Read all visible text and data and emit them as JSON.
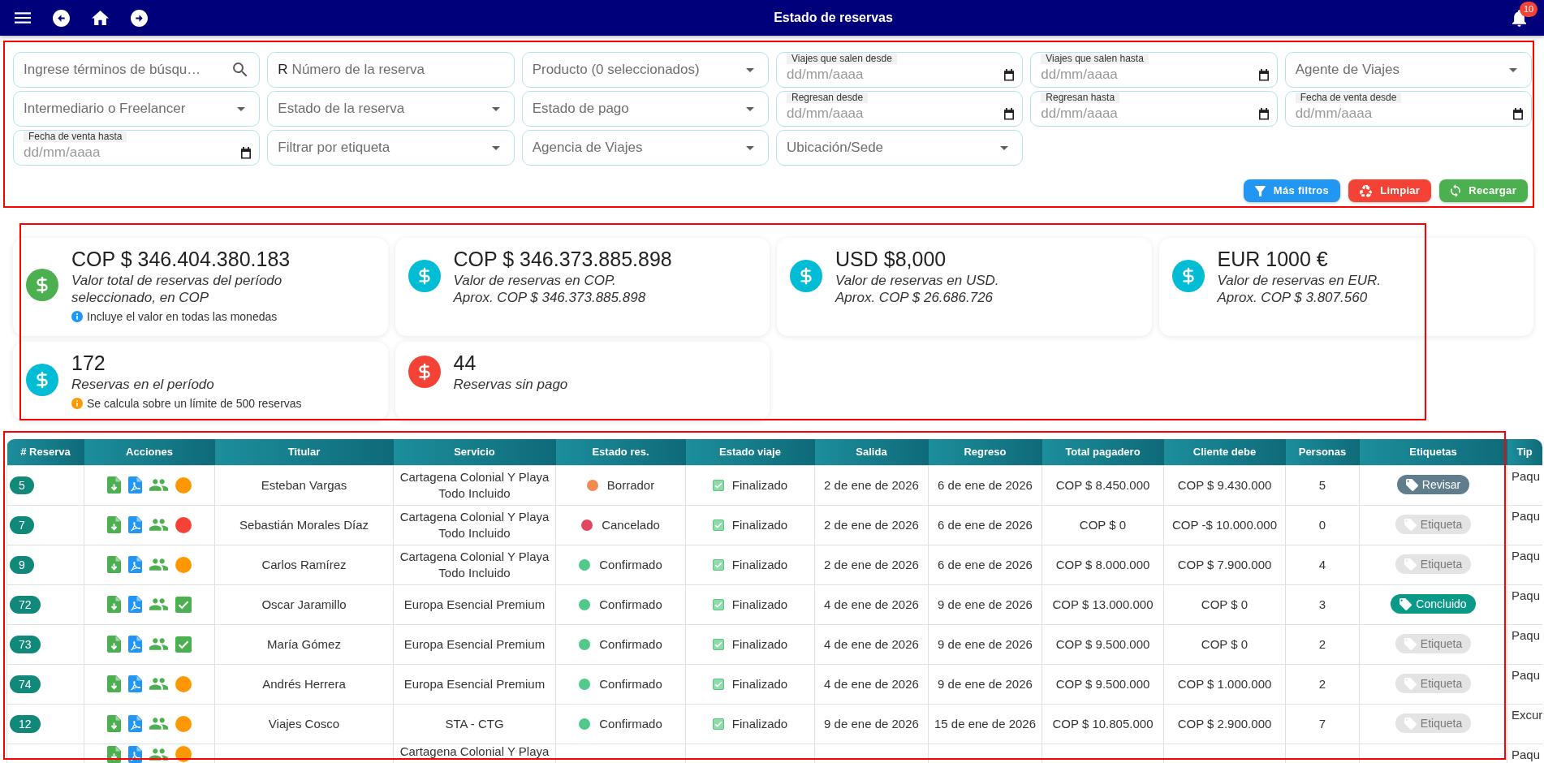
{
  "top_bar": {
    "title": "Estado de reservas",
    "notification_count": "10"
  },
  "filters": {
    "fields": [
      {
        "kind": "search",
        "placeholder": "Ingrese términos de búsqu…"
      },
      {
        "kind": "prefixed",
        "prefix": "R",
        "placeholder": "Número de la reserva"
      },
      {
        "kind": "select",
        "placeholder": "Producto (0 seleccionados)"
      },
      {
        "kind": "date",
        "label": "Viajes que salen desde",
        "placeholder": "dd/mm/aaaa"
      },
      {
        "kind": "date",
        "label": "Viajes que salen hasta",
        "placeholder": "dd/mm/aaaa"
      },
      {
        "kind": "select",
        "placeholder": "Agente de Viajes"
      },
      {
        "kind": "select",
        "placeholder": "Intermediario o Freelancer"
      },
      {
        "kind": "select",
        "placeholder": "Estado de la reserva"
      },
      {
        "kind": "select",
        "placeholder": "Estado de pago"
      },
      {
        "kind": "date",
        "label": "Regresan desde",
        "placeholder": "dd/mm/aaaa"
      },
      {
        "kind": "date",
        "label": "Regresan hasta",
        "placeholder": "dd/mm/aaaa"
      },
      {
        "kind": "date",
        "label": "Fecha de venta desde",
        "placeholder": "dd/mm/aaaa"
      },
      {
        "kind": "date",
        "label": "Fecha de venta hasta",
        "placeholder": "dd/mm/aaaa"
      },
      {
        "kind": "select",
        "placeholder": "Filtrar por etiqueta"
      },
      {
        "kind": "select",
        "placeholder": "Agencia de Viajes"
      },
      {
        "kind": "select",
        "placeholder": "Ubicación/Sede"
      }
    ],
    "buttons": [
      {
        "kind": "filter",
        "label": "Más filtros",
        "color": "#2196f3"
      },
      {
        "kind": "clear",
        "label": "Limpiar",
        "color": "#f44336"
      },
      {
        "kind": "reload",
        "label": "Recargar",
        "color": "#4caf50"
      }
    ]
  },
  "summary_cards": [
    {
      "value": "COP $ 346.404.380.183",
      "description": "Valor total de reservas del período seleccionado, en COP",
      "color": "#4caf50",
      "note": {
        "text": "Incluye el valor en todas las monedas",
        "color": "#2196f3"
      }
    },
    {
      "value": "COP $ 346.373.885.898",
      "description": "Valor de reservas en COP.",
      "approx": "Aprox. COP $ 346.373.885.898",
      "color": "#00bcd4"
    },
    {
      "value": "USD $8,000",
      "description": "Valor de reservas en USD.",
      "approx": "Aprox. COP $ 26.686.726",
      "color": "#00bcd4"
    },
    {
      "value": "EUR 1000 €",
      "description": "Valor de reservas en EUR.",
      "approx": "Aprox. COP $ 3.807.560",
      "color": "#00bcd4"
    },
    {
      "value": "172",
      "description": "Reservas en el período",
      "color": "#00bcd4",
      "note": {
        "text": "Se calcula sobre un límite de 500 reservas",
        "color": "#ff9800"
      }
    },
    {
      "value": "44",
      "description": "Reservas sin pago",
      "color": "#f44336"
    }
  ],
  "table": {
    "columns": [
      "# Reserva",
      "Acciones",
      "Titular",
      "Servicio",
      "Estado res.",
      "Estado viaje",
      "Salida",
      "Regreso",
      "Total pagadero",
      "Cliente debe",
      "Personas",
      "Etiquetas",
      "Tip"
    ],
    "rows": [
      {
        "id": "5",
        "status_marker": {
          "kind": "dot",
          "color": "#ff9800"
        },
        "holder": "Esteban Vargas",
        "service": "Cartagena Colonial Y Playa Todo Incluido",
        "status": {
          "label": "Borrador",
          "color": "#f28b50"
        },
        "trip_status": {
          "label": "Finalizado",
          "kind": "done"
        },
        "departure": "2 de ene de 2026",
        "return": "6 de ene de 2026",
        "total": "COP $ 8.450.000",
        "client_owes": "COP $ 9.430.000",
        "people": "5",
        "tag": {
          "label": "Revisar",
          "kind": "set",
          "color": "#5f7d8c"
        },
        "type": "Paqu"
      },
      {
        "id": "7",
        "status_marker": {
          "kind": "dot",
          "color": "#f44336"
        },
        "holder": "Sebastián Morales Díaz",
        "service": "Cartagena Colonial Y Playa Todo Incluido",
        "status": {
          "label": "Cancelado",
          "color": "#e0485f"
        },
        "trip_status": {
          "label": "Finalizado",
          "kind": "done"
        },
        "departure": "2 de ene de 2026",
        "return": "6 de ene de 2026",
        "total": "COP $ 0",
        "client_owes": "COP -$ 10.000.000",
        "people": "0",
        "tag": {
          "label": "Etiqueta",
          "kind": "empty"
        },
        "type": "Paqu"
      },
      {
        "id": "9",
        "status_marker": {
          "kind": "dot",
          "color": "#ff9800"
        },
        "holder": "Carlos Ramírez",
        "service": "Cartagena Colonial Y Playa Todo Incluido",
        "status": {
          "label": "Confirmado",
          "color": "#52c98a"
        },
        "trip_status": {
          "label": "Finalizado",
          "kind": "done"
        },
        "departure": "2 de ene de 2026",
        "return": "6 de ene de 2026",
        "total": "COP $ 8.000.000",
        "client_owes": "COP $ 7.900.000",
        "people": "4",
        "tag": {
          "label": "Etiqueta",
          "kind": "empty"
        },
        "type": "Paqu"
      },
      {
        "id": "72",
        "status_marker": {
          "kind": "check"
        },
        "holder": "Oscar Jaramillo",
        "service": "Europa Esencial Premium",
        "status": {
          "label": "Confirmado",
          "color": "#52c98a"
        },
        "trip_status": {
          "label": "Finalizado",
          "kind": "done"
        },
        "departure": "4 de ene de 2026",
        "return": "9 de ene de 2026",
        "total": "COP $ 13.000.000",
        "client_owes": "COP $ 0",
        "people": "3",
        "tag": {
          "label": "Concluido",
          "kind": "set",
          "color": "#0b9a87"
        },
        "type": "Paqu"
      },
      {
        "id": "73",
        "status_marker": {
          "kind": "check"
        },
        "holder": "María Gómez",
        "service": "Europa Esencial Premium",
        "status": {
          "label": "Confirmado",
          "color": "#52c98a"
        },
        "trip_status": {
          "label": "Finalizado",
          "kind": "done"
        },
        "departure": "4 de ene de 2026",
        "return": "9 de ene de 2026",
        "total": "COP $ 9.500.000",
        "client_owes": "COP $ 0",
        "people": "2",
        "tag": {
          "label": "Etiqueta",
          "kind": "empty"
        },
        "type": "Paqu"
      },
      {
        "id": "74",
        "status_marker": {
          "kind": "dot",
          "color": "#ff9800"
        },
        "holder": "Andrés Herrera",
        "service": "Europa Esencial Premium",
        "status": {
          "label": "Confirmado",
          "color": "#52c98a"
        },
        "trip_status": {
          "label": "Finalizado",
          "kind": "done"
        },
        "departure": "4 de ene de 2026",
        "return": "9 de ene de 2026",
        "total": "COP $ 9.500.000",
        "client_owes": "COP $ 1.000.000",
        "people": "2",
        "tag": {
          "label": "Etiqueta",
          "kind": "empty"
        },
        "type": "Paqu"
      },
      {
        "id": "12",
        "status_marker": {
          "kind": "dot",
          "color": "#ff9800"
        },
        "holder": "Viajes Cosco",
        "service": "STA - CTG",
        "status": {
          "label": "Confirmado",
          "color": "#52c98a"
        },
        "trip_status": {
          "label": "Finalizado",
          "kind": "done"
        },
        "departure": "9 de ene de 2026",
        "return": "15 de ene de 2026",
        "total": "COP $ 10.805.000",
        "client_owes": "COP $ 2.900.000",
        "people": "7",
        "tag": {
          "label": "Etiqueta",
          "kind": "empty"
        },
        "type": "Excur"
      },
      {
        "status_marker": {
          "kind": "dot",
          "color": "#ff9800"
        },
        "service": "Cartagena Colonial Y Playa",
        "type": "Paqu"
      }
    ]
  }
}
